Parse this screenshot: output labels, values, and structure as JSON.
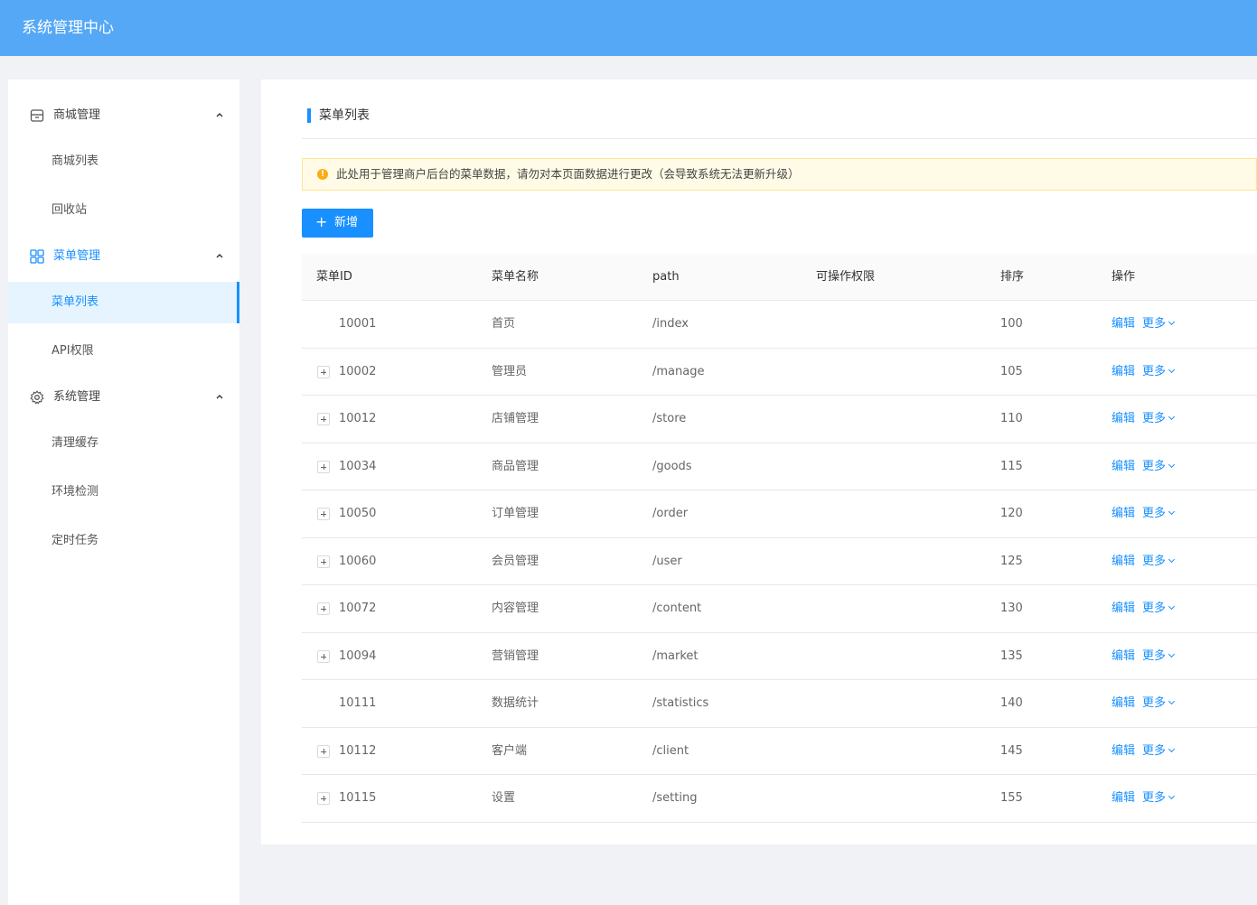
{
  "header": {
    "title": "系统管理中心"
  },
  "sidebar": {
    "groups": [
      {
        "label": "商城管理",
        "icon": "store-icon",
        "items": [
          "商城列表",
          "回收站"
        ]
      },
      {
        "label": "菜单管理",
        "icon": "grid-icon",
        "items": [
          "菜单列表",
          "API权限"
        ]
      },
      {
        "label": "系统管理",
        "icon": "gear-icon",
        "items": [
          "清理缓存",
          "环境检测",
          "定时任务"
        ]
      }
    ],
    "active_item": "菜单列表"
  },
  "page": {
    "title": "菜单列表",
    "notice": "此处用于管理商户后台的菜单数据，请勿对本页面数据进行更改（会导致系统无法更新升级）",
    "add_button": "新增"
  },
  "table": {
    "columns": [
      "菜单ID",
      "菜单名称",
      "path",
      "可操作权限",
      "排序",
      "操作"
    ],
    "rows": [
      {
        "id": "10001",
        "name": "首页",
        "path": "/index",
        "perm": "",
        "sort": "100",
        "expandable": false
      },
      {
        "id": "10002",
        "name": "管理员",
        "path": "/manage",
        "perm": "",
        "sort": "105",
        "expandable": true
      },
      {
        "id": "10012",
        "name": "店铺管理",
        "path": "/store",
        "perm": "",
        "sort": "110",
        "expandable": true
      },
      {
        "id": "10034",
        "name": "商品管理",
        "path": "/goods",
        "perm": "",
        "sort": "115",
        "expandable": true
      },
      {
        "id": "10050",
        "name": "订单管理",
        "path": "/order",
        "perm": "",
        "sort": "120",
        "expandable": true
      },
      {
        "id": "10060",
        "name": "会员管理",
        "path": "/user",
        "perm": "",
        "sort": "125",
        "expandable": true
      },
      {
        "id": "10072",
        "name": "内容管理",
        "path": "/content",
        "perm": "",
        "sort": "130",
        "expandable": true
      },
      {
        "id": "10094",
        "name": "营销管理",
        "path": "/market",
        "perm": "",
        "sort": "135",
        "expandable": true
      },
      {
        "id": "10111",
        "name": "数据统计",
        "path": "/statistics",
        "perm": "",
        "sort": "140",
        "expandable": false
      },
      {
        "id": "10112",
        "name": "客户端",
        "path": "/client",
        "perm": "",
        "sort": "145",
        "expandable": true
      },
      {
        "id": "10115",
        "name": "设置",
        "path": "/setting",
        "perm": "",
        "sort": "155",
        "expandable": true
      }
    ],
    "actions": {
      "edit": "编辑",
      "more": "更多"
    }
  },
  "colors": {
    "header": "#55a8f5",
    "primary": "#1890ff",
    "notice_bg": "#fffbe6"
  }
}
